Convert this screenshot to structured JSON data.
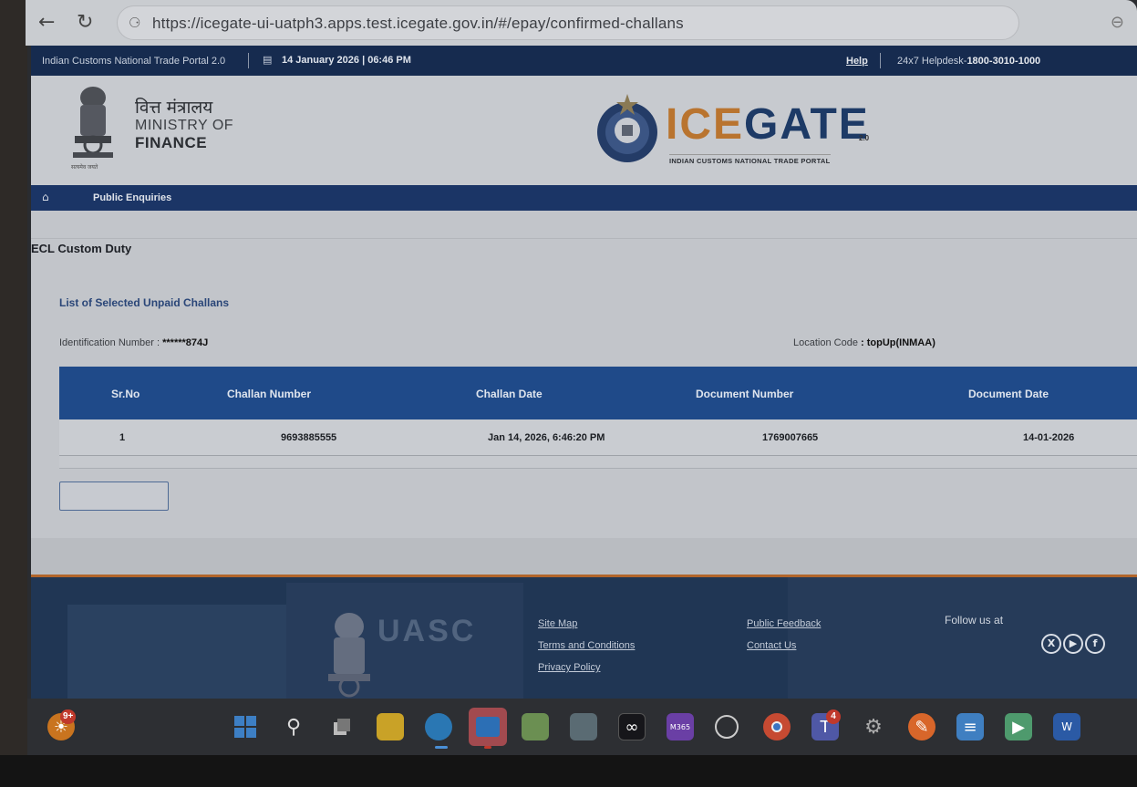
{
  "browser": {
    "url": "https://icegate-ui-uatph3.apps.test.icegate.gov.in/#/epay/confirmed-challans",
    "back_icon": "←",
    "reload_icon": "↻",
    "lock_icon": "🔒",
    "zoom_icon": "⊖"
  },
  "topstrip": {
    "portal_name": "Indian Customs National Trade Portal 2.0",
    "date_time": "14 January 2026 | 06:46 PM",
    "help": "Help",
    "helpdesk_label": "24x7 Helpdesk-",
    "helpdesk_number": "1800-3010-1000"
  },
  "header": {
    "ministry_hindi": "वित्त मंत्रालय",
    "ministry_line1": "MINISTRY OF",
    "ministry_line2": "FINANCE",
    "emblem_motto": "सत्यमेव जयते",
    "logo_text_orange": "ICE",
    "logo_text_blue": "GATE",
    "logo_version": "2.0",
    "logo_subtitle": "INDIAN CUSTOMS NATIONAL TRADE PORTAL"
  },
  "nav": {
    "home_icon": "⌂",
    "public_enquiries": "Public Enquiries"
  },
  "main": {
    "page_title": "ECL Custom Duty",
    "section_title": "List of Selected Unpaid Challans",
    "identification_label": "Identification Number : ",
    "identification_value": "******874J",
    "location_label": "Location Code ",
    "location_value": ": topUp(INMAA)"
  },
  "table": {
    "headers": [
      "Sr.No",
      "Challan Number",
      "Challan Date",
      "Document Number",
      "Document Date"
    ],
    "rows": [
      [
        "1",
        "9693885555",
        "Jan 14, 2026, 6:46:20 PM",
        "1769007665",
        "14-01-2026"
      ]
    ]
  },
  "footer": {
    "site_map": "Site Map",
    "terms": "Terms and Conditions",
    "privacy": "Privacy Policy",
    "public_feedback": "Public Feedback",
    "contact_us": "Contact Us",
    "follow_us": "Follow us at",
    "bg_text": "UASC",
    "social": [
      "X",
      "▶",
      "f"
    ]
  },
  "taskbar": {
    "weather_badge": "9+",
    "teams_badge": "4",
    "icons": [
      "widgets-icon",
      "start-icon",
      "search-icon",
      "task-view-icon",
      "file-explorer-icon",
      "edge-icon",
      "outlook-icon",
      "paint-icon",
      "app-icon",
      "copilot-icon",
      "m365-icon",
      "clock-icon",
      "chrome-icon",
      "teams-icon",
      "settings-icon",
      "pen-icon",
      "notepad-icon",
      "media-icon",
      "word-icon"
    ]
  }
}
